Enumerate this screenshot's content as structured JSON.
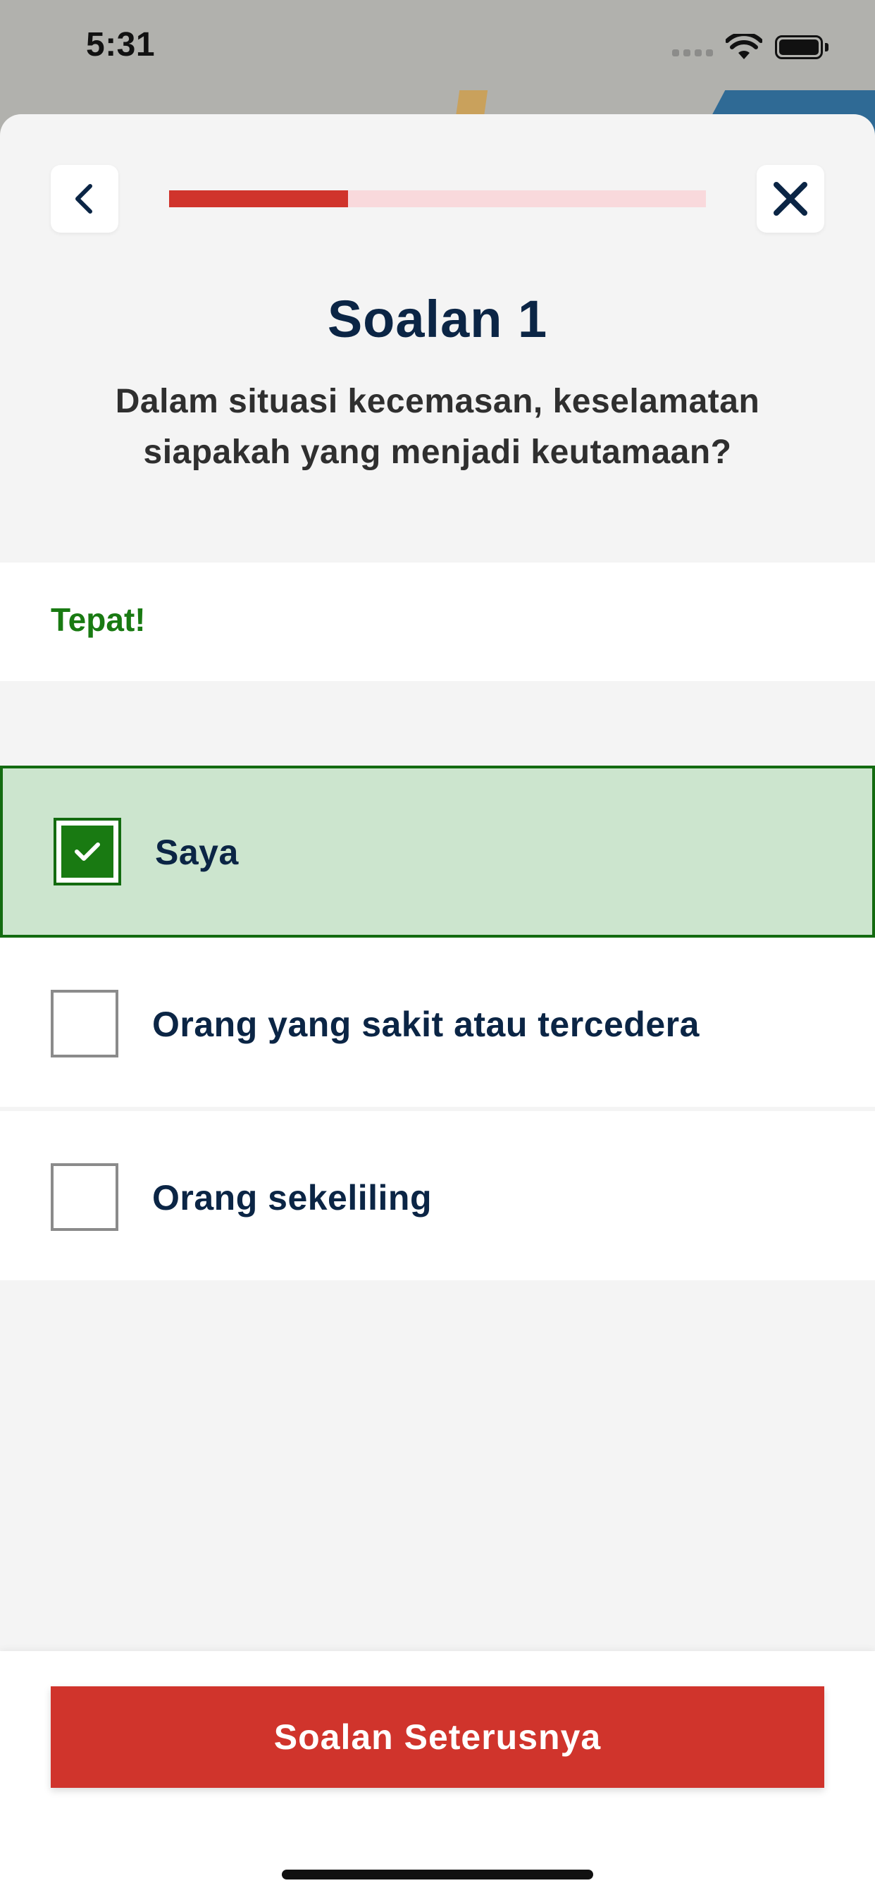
{
  "status_bar": {
    "time": "5:31",
    "icons": [
      "signal-icon",
      "wifi-icon",
      "battery-icon"
    ]
  },
  "nav": {
    "back_icon": "chevron-left-icon",
    "close_icon": "close-icon"
  },
  "progress": {
    "fraction": 0.333
  },
  "question": {
    "title": "Soalan 1",
    "text": "Dalam situasi kecemasan, keselamatan siapakah yang menjadi keutamaan?"
  },
  "feedback": {
    "text": "Tepat!"
  },
  "options": [
    {
      "label": "Saya",
      "selected": true
    },
    {
      "label": "Orang yang sakit atau tercedera",
      "selected": false
    },
    {
      "label": "Orang sekeliling",
      "selected": false
    }
  ],
  "footer": {
    "next_label": "Soalan Seterusnya"
  },
  "colors": {
    "accent_red": "#d0342c",
    "progress_track": "#f9d9dc",
    "correct_green": "#197a12",
    "selected_bg": "#cce5ce",
    "title_navy": "#0b2545"
  }
}
